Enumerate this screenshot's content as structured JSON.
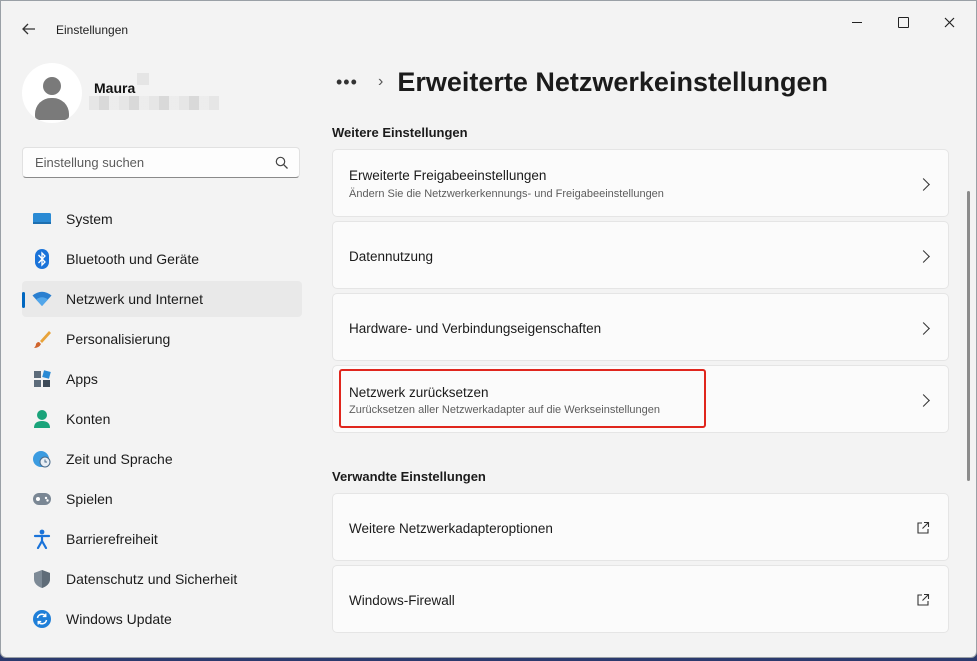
{
  "window": {
    "app_title": "Einstellungen",
    "back_icon": "arrow-left-icon",
    "controls": [
      "minimize-icon",
      "maximize-icon",
      "close-icon"
    ]
  },
  "profile": {
    "name": "Maura"
  },
  "search": {
    "placeholder": "Einstellung suchen",
    "value": ""
  },
  "nav": {
    "items": [
      {
        "label": "System",
        "icon": "monitor-icon"
      },
      {
        "label": "Bluetooth und Geräte",
        "icon": "bluetooth-icon"
      },
      {
        "label": "Netzwerk und Internet",
        "icon": "wifi-icon",
        "active": true
      },
      {
        "label": "Personalisierung",
        "icon": "brush-icon"
      },
      {
        "label": "Apps",
        "icon": "apps-icon"
      },
      {
        "label": "Konten",
        "icon": "person-icon"
      },
      {
        "label": "Zeit und Sprache",
        "icon": "globe-clock-icon"
      },
      {
        "label": "Spielen",
        "icon": "gamepad-icon"
      },
      {
        "label": "Barrierefreiheit",
        "icon": "accessibility-icon"
      },
      {
        "label": "Datenschutz und Sicherheit",
        "icon": "shield-icon"
      },
      {
        "label": "Windows Update",
        "icon": "sync-icon"
      }
    ]
  },
  "content": {
    "breadcrumb_more": "•••",
    "page_title": "Erweiterte Netzwerkeinstellungen",
    "section_more": "Weitere Einstellungen",
    "cards_more": [
      {
        "title": "Erweiterte Freigabeeinstellungen",
        "subtitle": "Ändern Sie die Netzwerkerkennungs- und Freigabeeinstellungen"
      },
      {
        "title": "Datennutzung"
      },
      {
        "title": "Hardware- und Verbindungseigenschaften"
      },
      {
        "title": "Netzwerk zurücksetzen",
        "subtitle": "Zurücksetzen aller Netzwerkadapter auf die Werkseinstellungen",
        "highlighted": true
      }
    ],
    "section_related": "Verwandte Einstellungen",
    "cards_related": [
      {
        "title": "Weitere Netzwerkadapteroptionen",
        "icon": "open-external-icon"
      },
      {
        "title": "Windows-Firewall",
        "icon": "open-external-icon"
      }
    ]
  },
  "colors": {
    "accent": "#0067c0",
    "highlight_border": "#e0261d",
    "window_bg": "#f3f3f3",
    "card_bg": "#fbfbfb"
  }
}
